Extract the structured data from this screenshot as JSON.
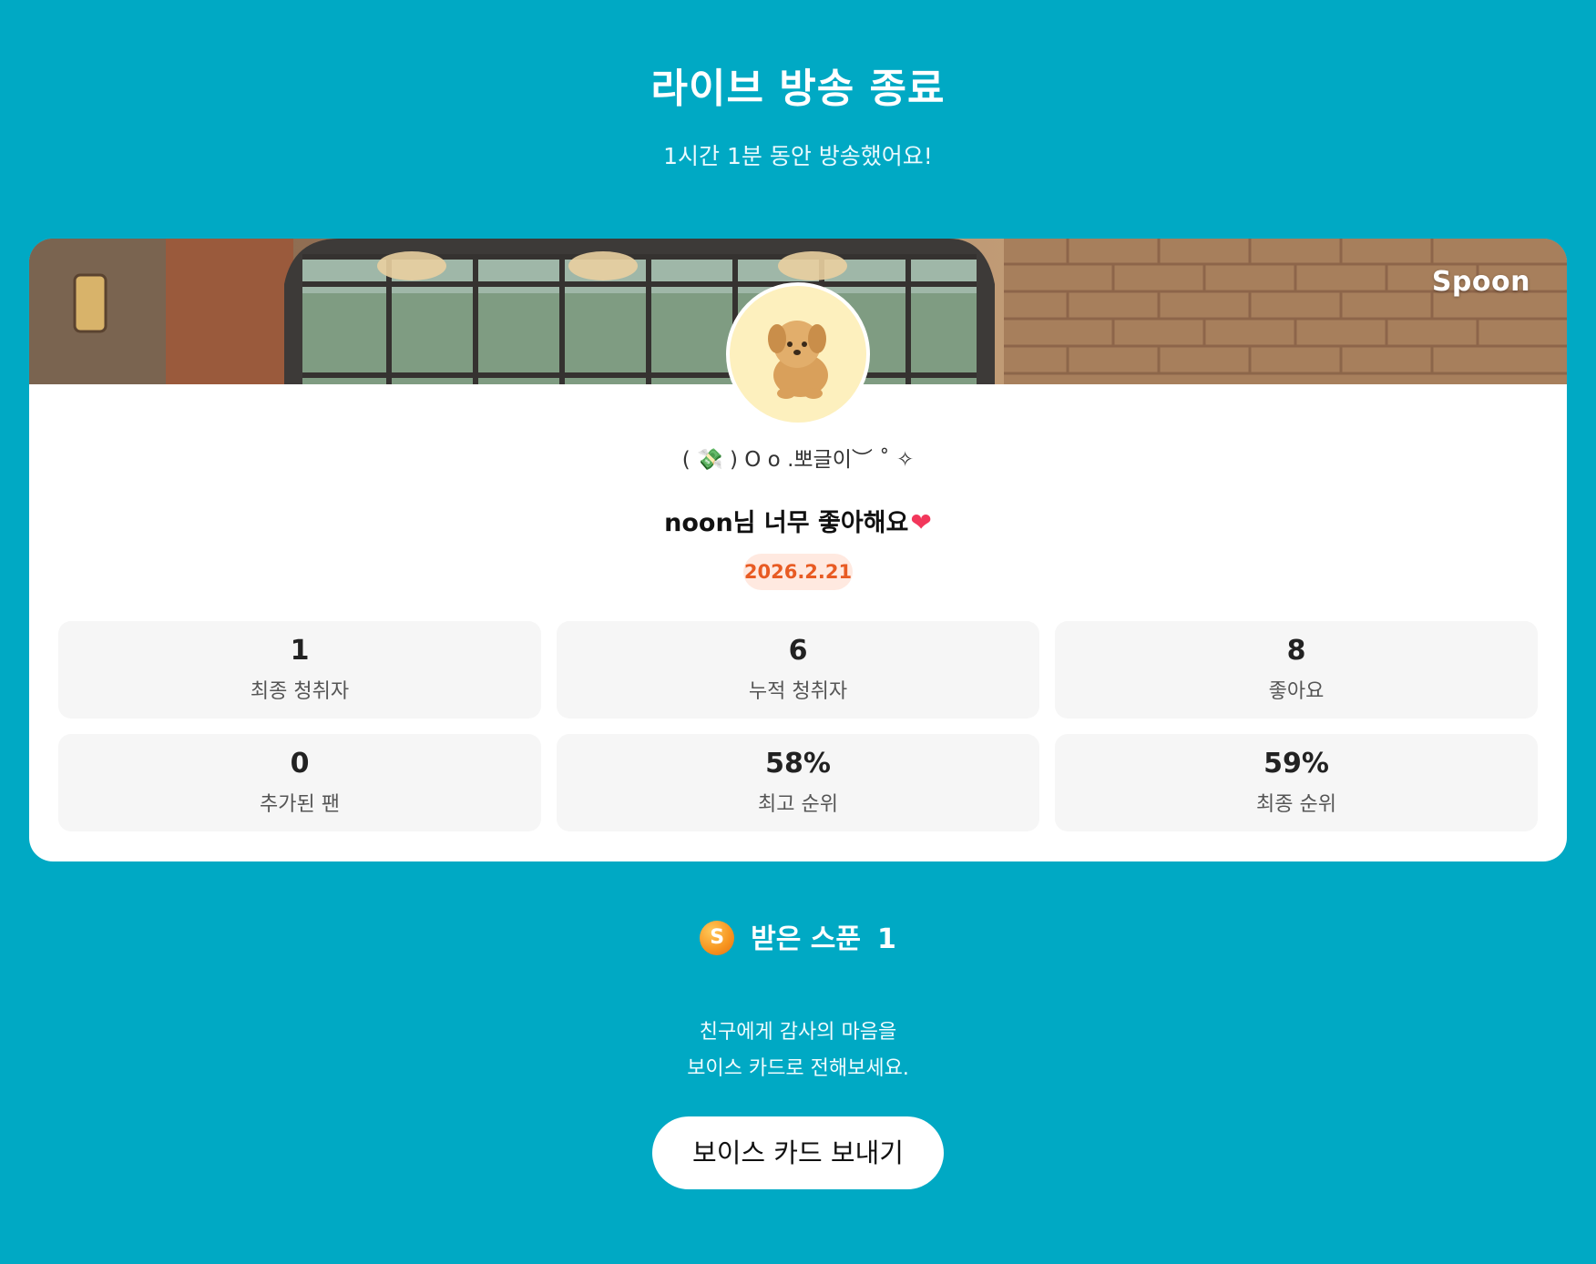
{
  "header": {
    "title": "라이브 방송 종료",
    "subtitle": "1시간 1분 동안 방송했어요!"
  },
  "card": {
    "brand": "Spoon",
    "avatar_icon": "puppy-avatar",
    "nickname": "( 💸 ) O o .뽀글이︶ ˚ ✧",
    "stream_title": "noon님 너무 좋아해요",
    "title_emoji": "❤",
    "date": "2026.2.21",
    "stats": [
      {
        "value": "1",
        "label": "최종 청취자"
      },
      {
        "value": "6",
        "label": "누적 청취자"
      },
      {
        "value": "8",
        "label": "좋아요"
      },
      {
        "value": "0",
        "label": "추가된 팬"
      },
      {
        "value": "58%",
        "label": "최고 순위"
      },
      {
        "value": "59%",
        "label": "최종 순위"
      }
    ]
  },
  "spoons": {
    "icon": "S",
    "label": "받은 스푼",
    "count": "1"
  },
  "message": {
    "line1": "친구에게 감사의 마음을",
    "line2": "보이스 카드로 전해보세요."
  },
  "cta": {
    "label": "보이스 카드 보내기"
  },
  "colors": {
    "background": "#00A9C4",
    "date_badge_bg": "#FFE9E0",
    "date_badge_text": "#E85B23",
    "stat_bg": "#F6F6F6"
  }
}
